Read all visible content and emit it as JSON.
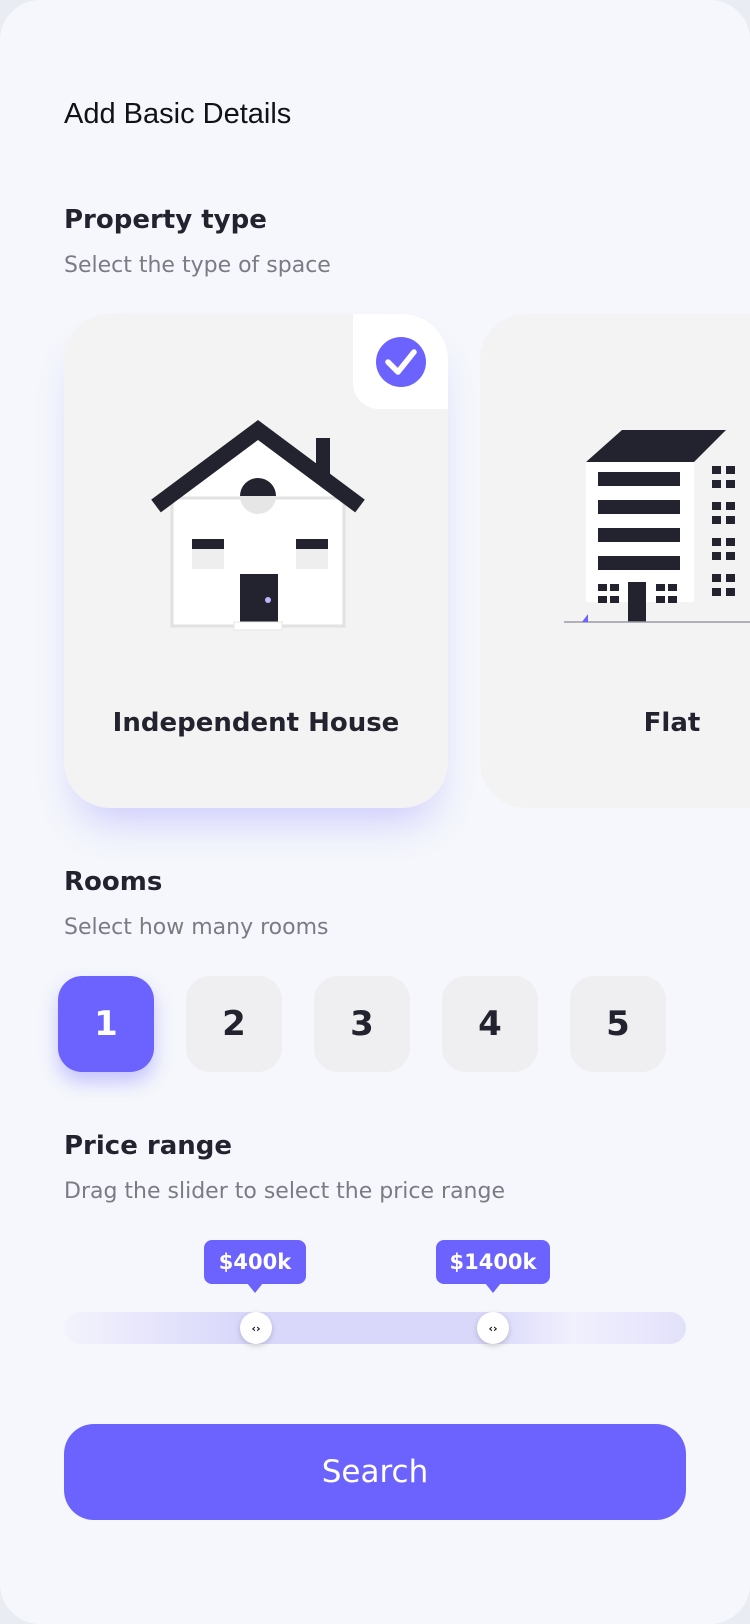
{
  "header": {
    "title": "Add Basic Details"
  },
  "property_type": {
    "title": "Property type",
    "subtitle": "Select the type of space",
    "options": [
      {
        "label": "Independent House",
        "selected": true,
        "icon": "house-icon"
      },
      {
        "label": "Flat",
        "selected": false,
        "icon": "apartment-building-icon"
      }
    ]
  },
  "rooms": {
    "title": "Rooms",
    "subtitle": "Select how many rooms",
    "options": [
      "1",
      "2",
      "3",
      "4",
      "5"
    ],
    "selected": "1"
  },
  "price_range": {
    "title": "Price range",
    "subtitle": "Drag the slider to select the price range",
    "min_label": "$400k",
    "max_label": "$1400k",
    "min_fraction": 0.3,
    "max_fraction": 0.67
  },
  "search_button": {
    "label": "Search"
  },
  "colors": {
    "accent": "#6c63ff",
    "background": "#f5f7fc",
    "card": "#f3f3f3",
    "text_dark": "#23232f",
    "text_muted": "#7b7b86"
  }
}
